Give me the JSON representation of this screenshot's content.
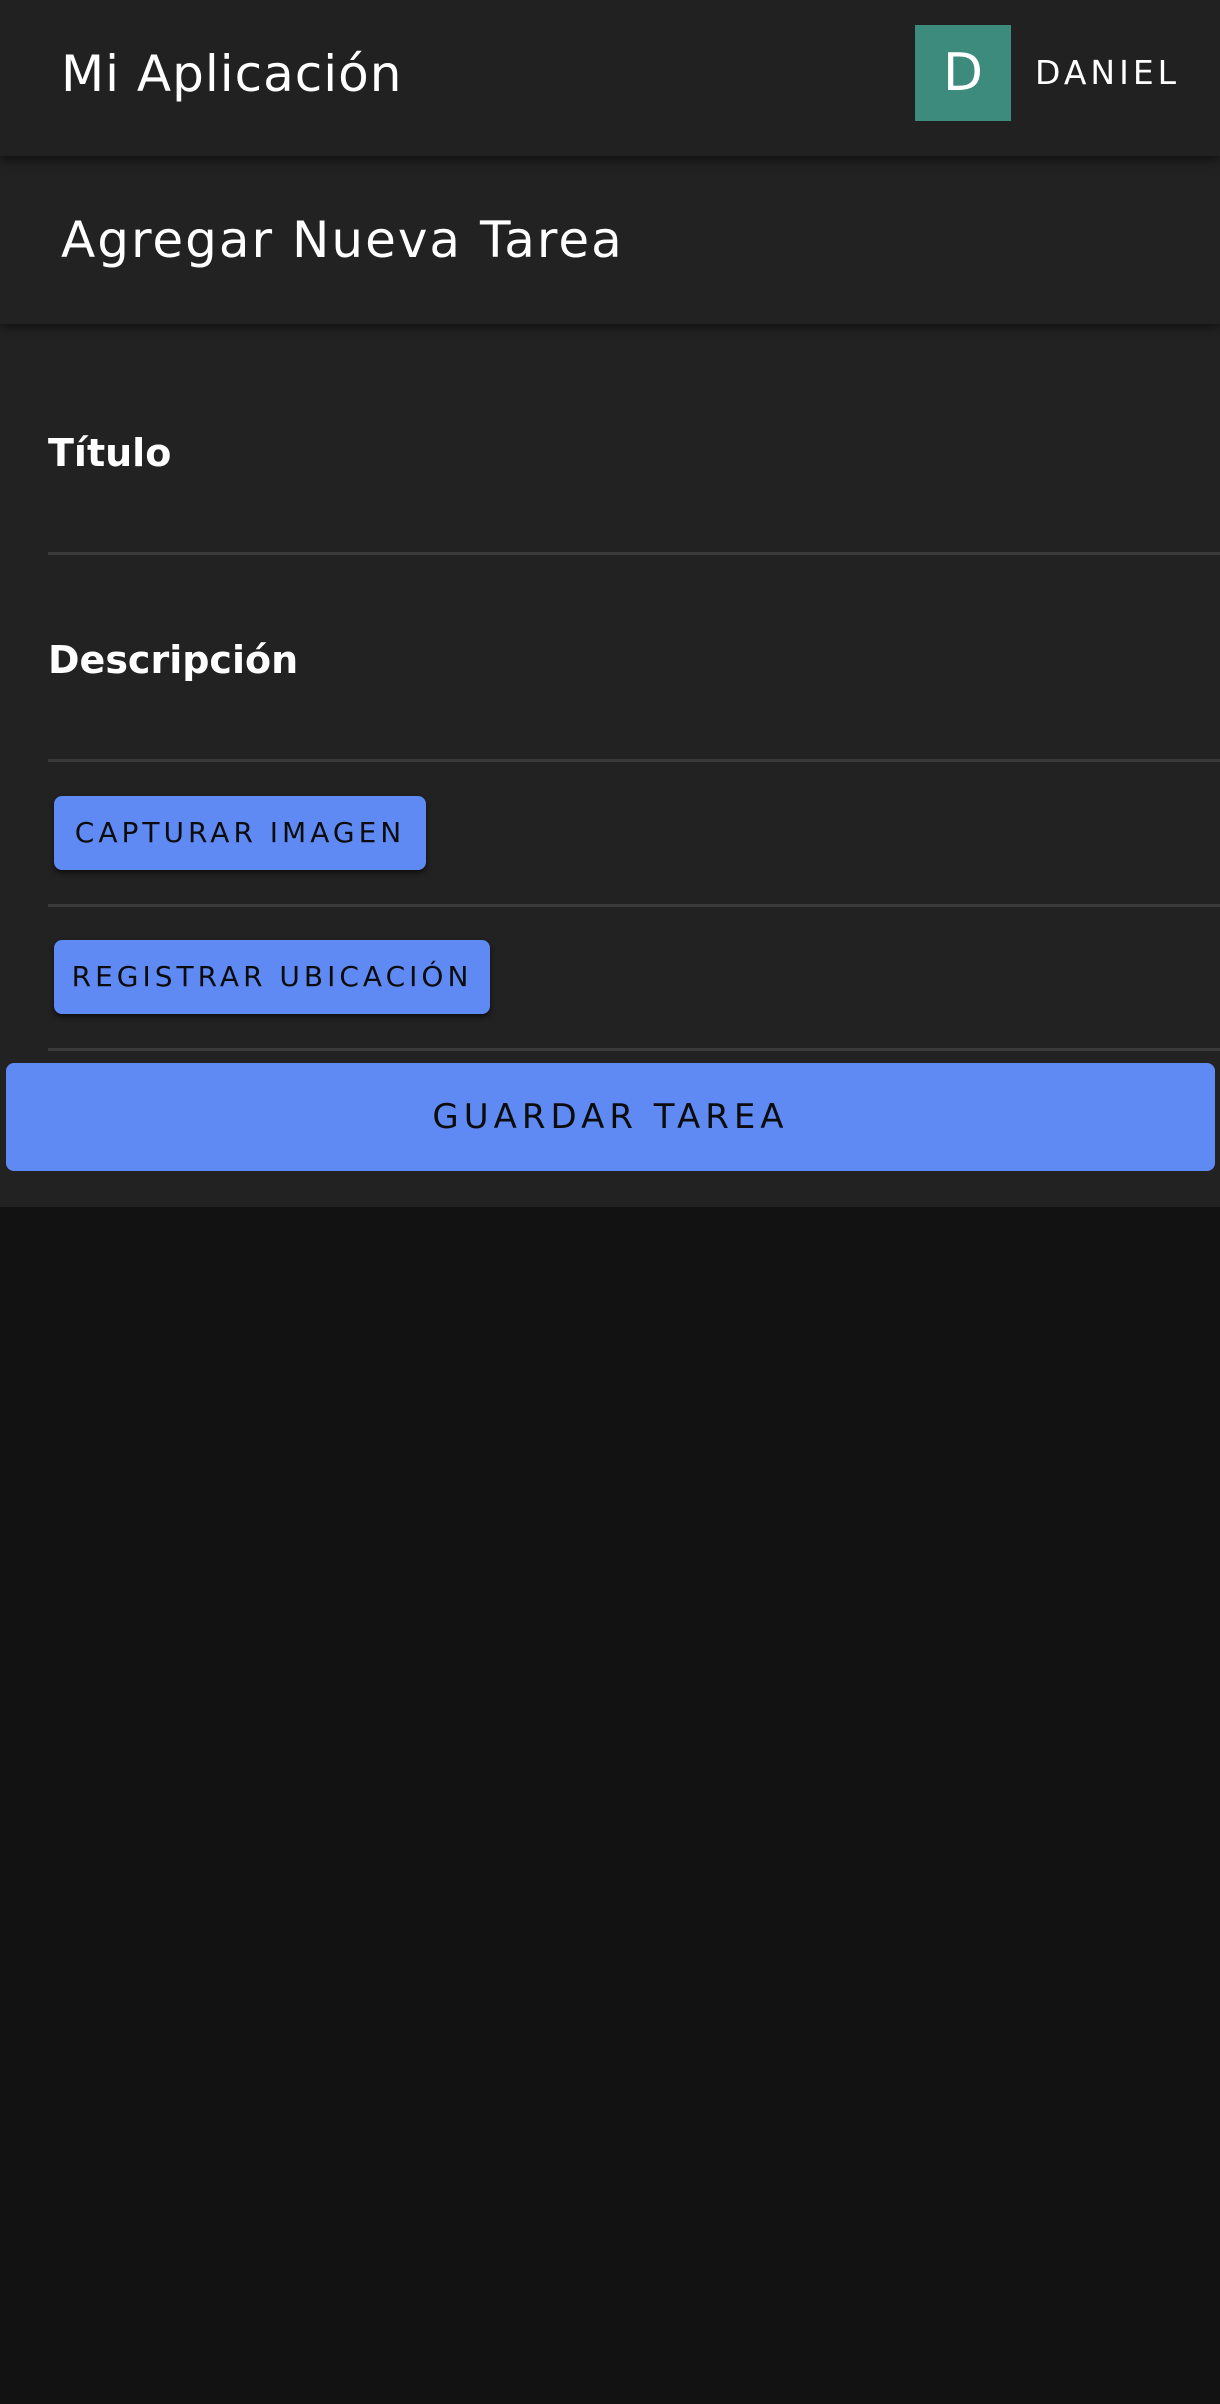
{
  "app_bar": {
    "title": "Mi Aplicación",
    "avatar_initial": "D",
    "user_name": "DANIEL"
  },
  "section": {
    "title": "Agregar Nueva Tarea"
  },
  "form": {
    "title_label": "Título",
    "title_value": "",
    "description_label": "Descripción",
    "description_value": "",
    "capture_image_label": "CAPTURAR IMAGEN",
    "register_location_label": "REGISTRAR UBICACIÓN",
    "save_label": "GUARDAR TAREA"
  },
  "colors": {
    "primary": "#5f8af4",
    "avatar": "#3d8b7d",
    "surface": "#222222",
    "background": "#121212"
  }
}
